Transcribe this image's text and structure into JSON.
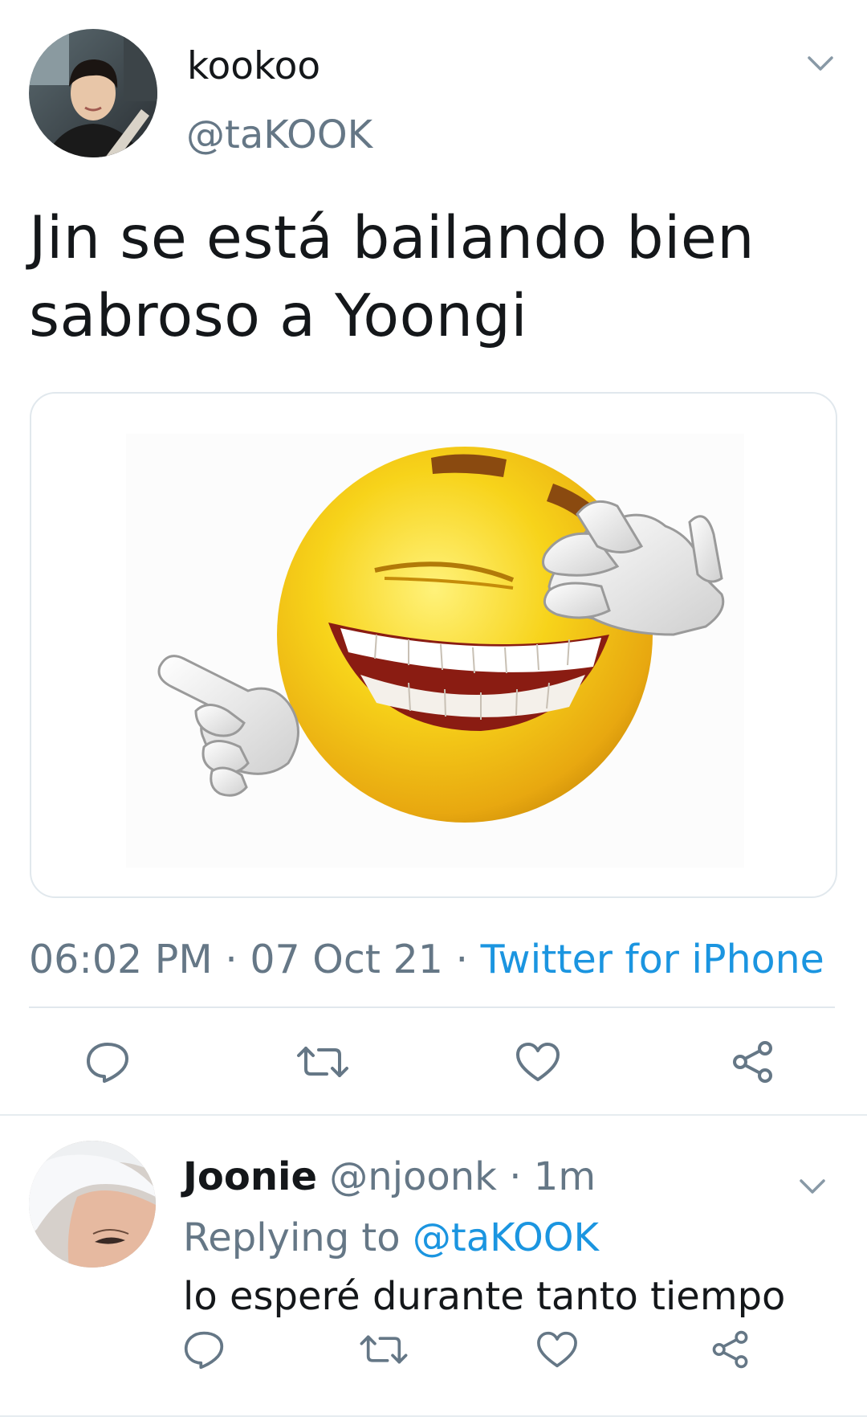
{
  "tweet": {
    "author_name": "kookoo",
    "author_handle": "@taKOOK",
    "text": "Jin se está bailando bien sabroso a Yoongi",
    "time": "06:02 PM",
    "date": "07 Oct 21",
    "separator": "·",
    "source": "Twitter for iPhone",
    "media_icon": "laughing-emoji-face-palm",
    "actions": [
      {
        "icon": "reply-icon"
      },
      {
        "icon": "retweet-icon"
      },
      {
        "icon": "like-icon"
      },
      {
        "icon": "share-icon"
      }
    ]
  },
  "reply": {
    "author_name": "Joonie",
    "author_handle": "@njoonk",
    "separator": "·",
    "age": "1m",
    "replying_prefix": "Replying to",
    "replying_to": "@taKOOK",
    "text": "lo esperé durante tanto tiempo"
  },
  "colors": {
    "link": "#1b95e0",
    "secondary_text": "#657786",
    "primary_text": "#14171a",
    "divider": "#e1e8ed"
  }
}
